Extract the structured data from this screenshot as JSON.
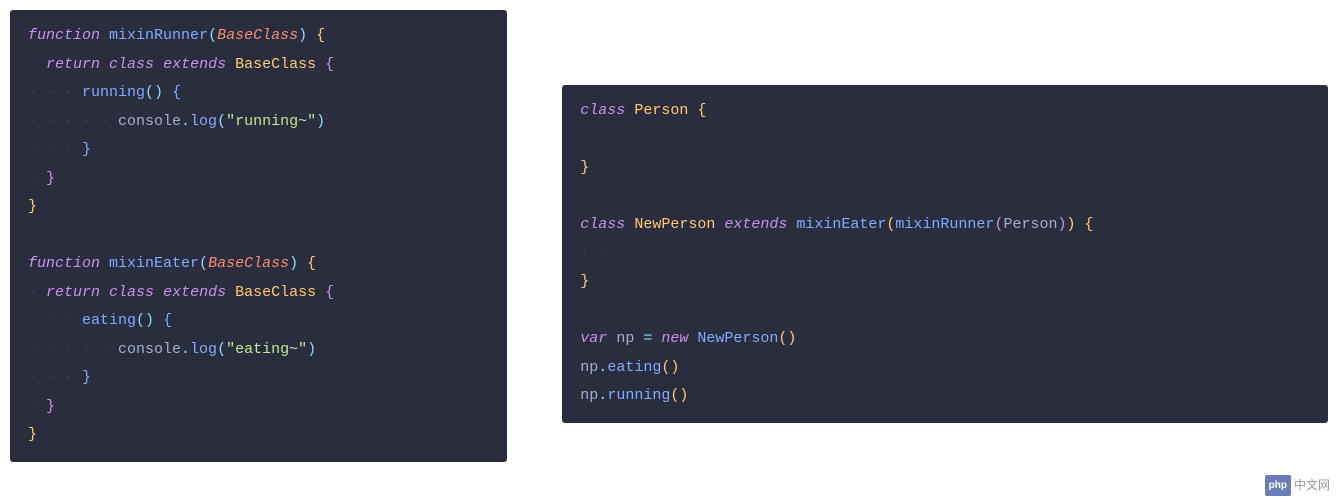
{
  "left": {
    "l1": {
      "kw_function": "function",
      "fn": "mixinRunner",
      "param": "BaseClass",
      "brace": "{"
    },
    "l2": {
      "kw_return": "return",
      "kw_class": "class",
      "kw_extends": "extends",
      "base": "BaseClass",
      "brace": "{"
    },
    "l3": {
      "method": "running",
      "parens": "()",
      "brace": "{"
    },
    "l4": {
      "obj": "console",
      "dot": ".",
      "fn": "log",
      "paren_open": "(",
      "str": "\"running~\"",
      "paren_close": ")"
    },
    "l5": {
      "brace": "}"
    },
    "l6": {
      "brace": "}"
    },
    "l7": {
      "brace": "}"
    },
    "l9": {
      "kw_function": "function",
      "fn": "mixinEater",
      "param": "BaseClass",
      "brace": "{"
    },
    "l10": {
      "kw_return": "return",
      "kw_class": "class",
      "kw_extends": "extends",
      "base": "BaseClass",
      "brace": "{"
    },
    "l11": {
      "method": "eating",
      "parens": "()",
      "brace": "{"
    },
    "l12": {
      "obj": "console",
      "dot": ".",
      "fn": "log",
      "paren_open": "(",
      "str": "\"eating~\"",
      "paren_close": ")"
    },
    "l13": {
      "brace": "}"
    },
    "l14": {
      "brace": "}"
    },
    "l15": {
      "brace": "}"
    }
  },
  "right": {
    "l1": {
      "kw_class": "class",
      "cls": "Person",
      "brace": "{"
    },
    "l3": {
      "brace": "}"
    },
    "l5": {
      "kw_class": "class",
      "cls": "NewPerson",
      "kw_extends": "extends",
      "fn1": "mixinEater",
      "fn2": "mixinRunner",
      "param": "Person",
      "brace": "{"
    },
    "l7": {
      "brace": "}"
    },
    "l9": {
      "kw_var": "var",
      "var": "np",
      "eq": "=",
      "kw_new": "new",
      "cls": "NewPerson",
      "parens": "()"
    },
    "l10": {
      "obj": "np",
      "dot": ".",
      "method": "eating",
      "parens": "()"
    },
    "l11": {
      "obj": "np",
      "dot": ".",
      "method": "running",
      "parens": "()"
    }
  },
  "watermark": {
    "badge": "php",
    "text": "中文网"
  }
}
